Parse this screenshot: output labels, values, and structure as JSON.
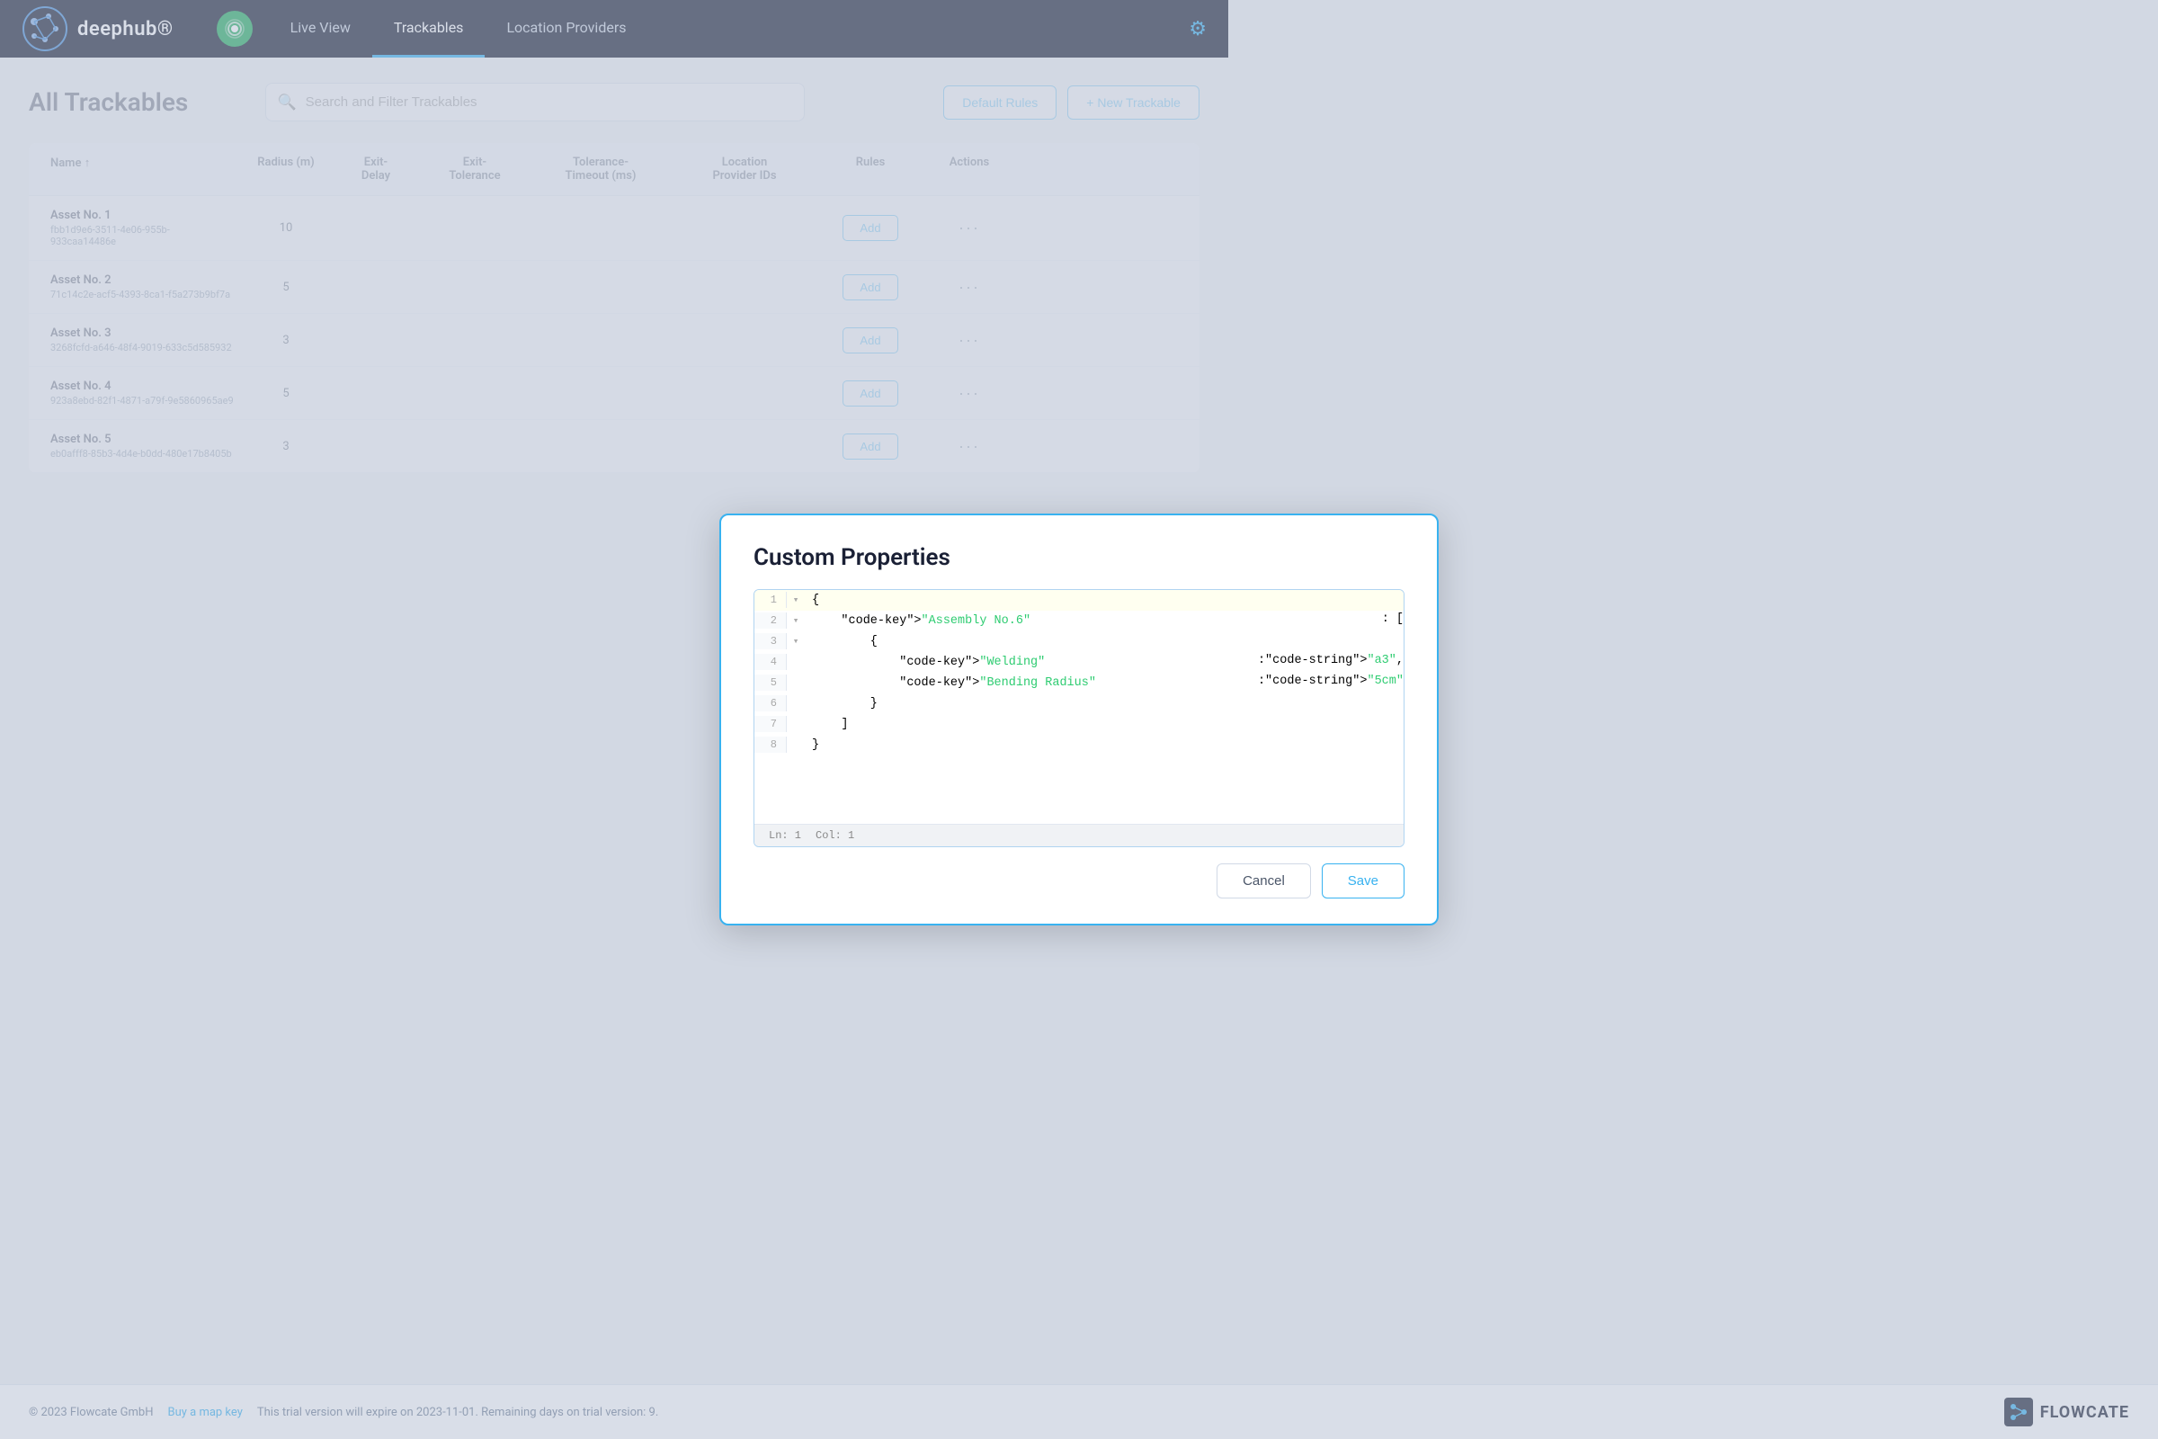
{
  "app": {
    "name": "deephub",
    "tagline": "deephub®"
  },
  "navbar": {
    "live_view_label": "Live View",
    "trackables_label": "Trackables",
    "location_providers_label": "Location Providers",
    "active_tab": "Trackables"
  },
  "page": {
    "title": "All Trackables",
    "search_placeholder": "Search and Filter Trackables",
    "default_rules_label": "Default Rules",
    "new_trackable_label": "+ New Trackable"
  },
  "table": {
    "headers": [
      "Name ↑",
      "Radius (m)",
      "Exit-Delay",
      "Exit-Tolerance",
      "Tolerance-Timeout (ms)",
      "Location Provider IDs",
      "Rules",
      "Actions"
    ],
    "rows": [
      {
        "name": "Asset No. 1",
        "uuid": "fbb1d9e6-3511-4e06-955b-933caa14486e",
        "radius": "10",
        "exit_delay": "",
        "exit_tolerance": "",
        "tolerance_timeout": "",
        "location_provider_ids": "",
        "rules_label": "Add",
        "actions_dots": "···"
      },
      {
        "name": "Asset No. 2",
        "uuid": "71c14c2e-acf5-4393-8ca1-f5a273b9bf7a",
        "radius": "5",
        "exit_delay": "",
        "exit_tolerance": "",
        "tolerance_timeout": "",
        "location_provider_ids": "",
        "rules_label": "Add",
        "actions_dots": "···"
      },
      {
        "name": "Asset No. 3",
        "uuid": "3268fcfd-a646-48f4-9019-633c5d585932",
        "radius": "3",
        "exit_delay": "",
        "exit_tolerance": "",
        "tolerance_timeout": "",
        "location_provider_ids": "",
        "rules_label": "Add",
        "actions_dots": "···"
      },
      {
        "name": "Asset No. 4",
        "uuid": "923a8ebd-82f1-4871-a79f-9e5860965ae9",
        "radius": "5",
        "exit_delay": "",
        "exit_tolerance": "",
        "tolerance_timeout": "",
        "location_provider_ids": "",
        "rules_label": "Add",
        "actions_dots": "···"
      },
      {
        "name": "Asset No. 5",
        "uuid": "eb0afff8-85b3-4d4e-b0dd-480e17b8405b",
        "radius": "3",
        "exit_delay": "",
        "exit_tolerance": "",
        "tolerance_timeout": "",
        "location_provider_ids": "",
        "rules_label": "Add",
        "actions_dots": "···"
      }
    ]
  },
  "modal": {
    "title": "Custom Properties",
    "code_lines": [
      {
        "num": "1",
        "indicator": "▾",
        "code": "{",
        "highlight": true
      },
      {
        "num": "2",
        "indicator": "▾",
        "code": "    \"Assembly No.6\": [",
        "highlight": false
      },
      {
        "num": "3",
        "indicator": "▾",
        "code": "        {",
        "highlight": false
      },
      {
        "num": "4",
        "indicator": " ",
        "code": "            \"Welding\": \"a3\",",
        "highlight": false
      },
      {
        "num": "5",
        "indicator": " ",
        "code": "            \"Bending Radius\": \"5cm\"",
        "highlight": false
      },
      {
        "num": "6",
        "indicator": " ",
        "code": "        }",
        "highlight": false
      },
      {
        "num": "7",
        "indicator": " ",
        "code": "    ]",
        "highlight": false
      },
      {
        "num": "8",
        "indicator": " ",
        "code": "}",
        "highlight": false
      }
    ],
    "status_bar": {
      "line": "Ln: 1",
      "col": "Col: 1"
    },
    "cancel_label": "Cancel",
    "save_label": "Save"
  },
  "footer": {
    "copyright": "© 2023 Flowcate GmbH",
    "buy_map_key": "Buy a map key",
    "trial_text": "This trial version will expire on 2023-11-01. Remaining days on trial version: 9.",
    "brand_name": "FLOWCATE"
  }
}
